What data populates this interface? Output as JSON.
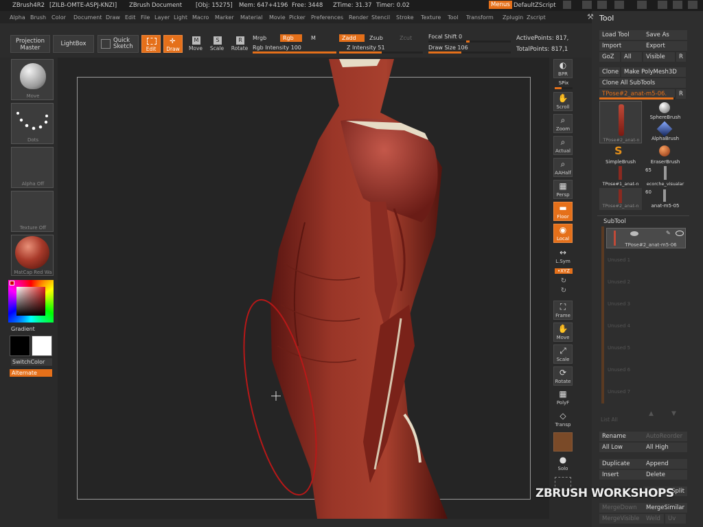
{
  "titlebar": {
    "app": "ZBrush4R2",
    "serial": "[ZILB-OMTE-ASPJ-KNZI]",
    "doc": "ZBrush Document",
    "obj": "[Obj: 15275]",
    "mem": "Mem: 647+4196",
    "free": "Free: 3448",
    "ztime": "ZTime: 31.37",
    "timer": "Timer: 0.02",
    "menus": "Menus",
    "script": "DefaultZScript"
  },
  "menubar": [
    "Alpha",
    "Brush",
    "Color",
    "Document",
    "Draw",
    "Edit",
    "File",
    "Layer",
    "Light",
    "Macro",
    "Marker",
    "Material",
    "Movie",
    "Picker",
    "Preferences",
    "Render",
    "Stencil",
    "Stroke",
    "Texture",
    "Tool",
    "Transform",
    "Zplugin",
    "Zscript"
  ],
  "toolbar": {
    "projection_master": "Projection Master",
    "lightbox": "LightBox",
    "quick_sketch": "Quick Sketch",
    "edit": "Edit",
    "draw": "Draw",
    "move": "Move",
    "scale": "Scale",
    "rotate": "Rotate",
    "mrgb": "Mrgb",
    "rgb": "Rgb",
    "m": "M",
    "rgb_intensity": "Rgb Intensity 100",
    "zadd": "Zadd",
    "zsub": "Zsub",
    "zcut": "Zcut",
    "z_intensity": "Z Intensity 51",
    "z_intensity_value": 51,
    "focal_shift": "Focal Shift 0",
    "draw_size": "Draw Size 106",
    "draw_size_value": 106,
    "active_points": "ActivePoints: 817,",
    "total_points": "TotalPoints: 817,1"
  },
  "left_shelf": {
    "brush": "Move",
    "stroke": "Dots",
    "alpha": "Alpha Off",
    "texture": "Texture Off",
    "material": "MatCap Red Wa",
    "gradient": "Gradient",
    "switch_color": "SwitchColor",
    "alternate": "Alternate"
  },
  "right_shelf": {
    "bpr": "BPR",
    "spix": "SPix",
    "scroll": "Scroll",
    "zoom": "Zoom",
    "actual": "Actual",
    "aahalf": "AAHalf",
    "persp": "Persp",
    "floor": "Floor",
    "local": "Local",
    "lsym": "L.Sym",
    "xyz": "•XYZ",
    "frame": "Frame",
    "move": "Move",
    "scale": "Scale",
    "rotate": "Rotate",
    "polyf": "PolyF",
    "transp": "Transp",
    "solo": "Solo"
  },
  "tool_panel": {
    "title": "Tool",
    "load_tool": "Load Tool",
    "save_as": "Save As",
    "import": "Import",
    "export": "Export",
    "goz": "GoZ",
    "all": "All",
    "visible": "Visible",
    "r": "R",
    "clone": "Clone",
    "make_polymesh": "Make PolyMesh3D",
    "clone_all": "Clone All SubTools",
    "current_tool": "TPose#2_anat-m5-06.",
    "thumbs": [
      {
        "name": "TPose#2_anat-n"
      },
      {
        "name": "SphereBrush"
      },
      {
        "name": "AlphaBrush"
      },
      {
        "name": "SimpleBrush"
      },
      {
        "name": "EraserBrush"
      },
      {
        "name": "TPose#1_anat-n"
      },
      {
        "name": "ecorche_visualar"
      },
      {
        "name": "TPose#2_anat-n"
      },
      {
        "name": "anat-m5-05"
      }
    ],
    "count_65": "65",
    "count_60": "60",
    "subtool_title": "SubTool",
    "subtool_active": "TPose#2_anat-m5-06",
    "empty_slots": [
      "Unused 1",
      "Unused 2",
      "Unused 3",
      "Unused 4",
      "Unused 5",
      "Unused 6",
      "Unused 7"
    ],
    "list_all": "List All",
    "rename": "Rename",
    "auto_reorder": "AutoReorder",
    "all_low": "All Low",
    "all_high": "All High",
    "duplicate": "Duplicate",
    "append": "Append",
    "insert": "Insert",
    "delete": "Delete",
    "split": "Split",
    "merge_down": "MergeDown",
    "merge_similar": "MergeSimilar",
    "merge_visible": "MergeVisible",
    "weld": "Weld",
    "uv": "Uv"
  },
  "watermark": "ZBRUSH WORKSHOPS",
  "colors": {
    "accent": "#e5701a",
    "muscle": "#8a2a22",
    "brush_ring": "#b81818"
  }
}
